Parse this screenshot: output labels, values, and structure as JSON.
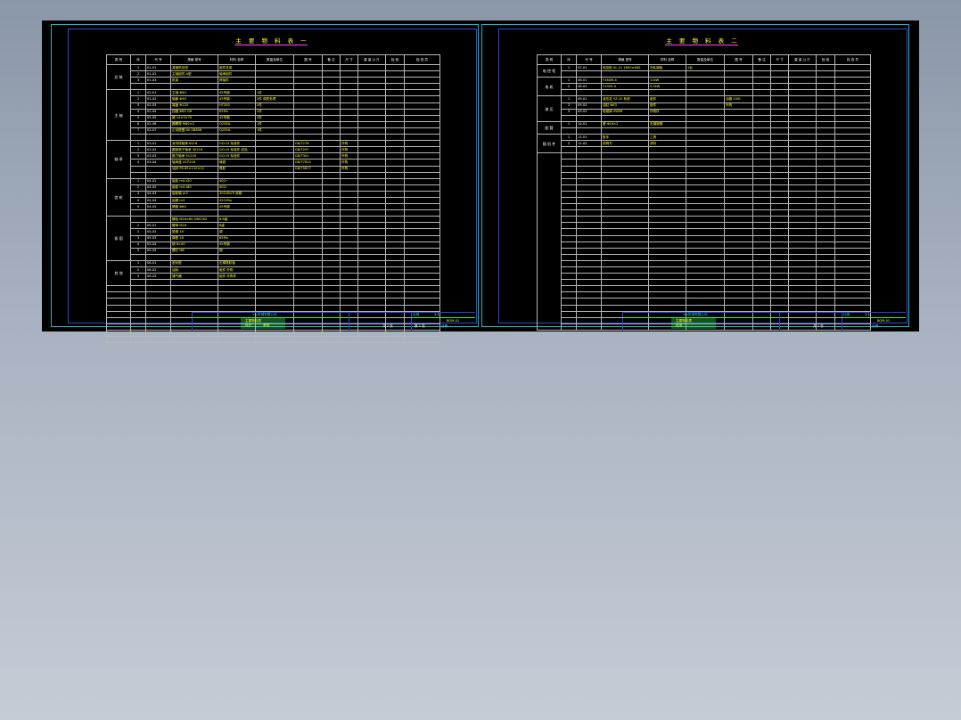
{
  "columns": [
    "类 别",
    "序",
    "代 号",
    "规格 型号",
    "材料 名称",
    "数量及单位",
    "图 号",
    "备 注",
    "尺 寸",
    "重 量 公 斤",
    "检 验",
    "检 查 员"
  ],
  "sheets": [
    {
      "title": "主 要 物 料 表 一",
      "groups": [
        {
          "category": "总 装",
          "rows": [
            {
              "idx": "1",
              "code": "01-01",
              "spec": "减速机总成",
              "name": "组件总成",
              "qty": "",
              "extra": ""
            },
            {
              "idx": "2",
              "code": "01-02",
              "spec": "主轴组件 A型",
              "name": "轴承组件",
              "qty": "",
              "extra": ""
            },
            {
              "idx": "3",
              "code": "01-03",
              "spec": "机架",
              "name": "焊接件",
              "qty": "",
              "extra": ""
            }
          ]
        },
        {
          "category": "主 轴",
          "rows": [
            {
              "idx": "1",
              "code": "02-01",
              "spec": "主轴 Φ80",
              "name": "45号钢",
              "qty": "1件",
              "extra": ""
            },
            {
              "idx": "2",
              "code": "02-02",
              "spec": "轴套 Φ90",
              "name": "45号钢",
              "qty": "2件 调质处理",
              "extra": ""
            },
            {
              "idx": "3",
              "code": "02-03",
              "spec": "端盖 Φ120",
              "name": "HT200",
              "qty": "2件",
              "extra": ""
            },
            {
              "idx": "4",
              "code": "02-04",
              "spec": "挡圈 Φ80 GB",
              "name": "65Mn",
              "qty": "2件",
              "extra": ""
            },
            {
              "idx": "5",
              "code": "02-05",
              "spec": "键 14×9×70",
              "name": "45号钢",
              "qty": "2件",
              "extra": ""
            },
            {
              "idx": "6",
              "code": "02-06",
              "spec": "圆螺母 M80×2",
              "name": "Q235A",
              "qty": "1件",
              "extra": ""
            },
            {
              "idx": "7",
              "code": "02-07",
              "spec": "止动垫圈 80 GB858",
              "name": "Q235A",
              "qty": "1件",
              "extra": ""
            }
          ]
        },
        {
          "category": "轴 承",
          "rows": [
            {
              "idx": "1",
              "code": "03-01",
              "spec": "深沟球轴承 6216",
              "name": "GCr15 标准件",
              "qty": "",
              "extra": "GB/T276",
              "extra2": "外购"
            },
            {
              "idx": "2",
              "code": "03-02",
              "spec": "圆锥滚子轴承 30216",
              "name": "GCr15 标准件 成品",
              "qty": "",
              "extra": "GB/T297",
              "extra2": "外购"
            },
            {
              "idx": "3",
              "code": "03-03",
              "spec": "推力轴承 51216",
              "name": "GCr15 标准件",
              "qty": "",
              "extra": "GB/T301",
              "extra2": "外购"
            },
            {
              "idx": "4",
              "code": "03-04",
              "spec": "轴承座 UCP216",
              "name": "铸铁",
              "qty": "",
              "extra": "GB/T7810",
              "extra2": "外购"
            },
            {
              "idx": "",
              "code": "",
              "spec": "油封 FB 85×110×12",
              "name": "橡胶",
              "qty": "",
              "extra": "GB/T9877",
              "extra2": "外购"
            }
          ]
        },
        {
          "category": "齿 轮",
          "rows": [
            {
              "idx": "1",
              "code": "04-01",
              "spec": "齿轮 m4 z20",
              "name": "40Cr",
              "qty": "",
              "extra": ""
            },
            {
              "idx": "2",
              "code": "04-02",
              "spec": "齿轮 m4 z80",
              "name": "40Cr",
              "qty": "",
              "extra": ""
            },
            {
              "idx": "3",
              "code": "04-03",
              "spec": "齿轮轴 m3",
              "name": "20CrMnTi 渗碳",
              "qty": "",
              "extra": ""
            },
            {
              "idx": "4",
              "code": "04-04",
              "spec": "齿圈 m3",
              "name": "42CrMo",
              "qty": "",
              "extra": ""
            },
            {
              "idx": "5",
              "code": "04-05",
              "spec": "隔套 Φ60",
              "name": "45号钢",
              "qty": "",
              "extra": ""
            }
          ]
        },
        {
          "category": "紧 固",
          "rows": [
            {
              "idx": "",
              "code": "",
              "spec": "螺栓 M16×60 GB5782",
              "name": "8.8级",
              "qty": "",
              "extra": ""
            },
            {
              "idx": "1",
              "code": "05-01",
              "spec": "螺母 M16",
              "name": "8级",
              "qty": "",
              "extra": ""
            },
            {
              "idx": "2",
              "code": "05-02",
              "spec": "垫圈 16",
              "name": "钢",
              "qty": "",
              "extra": ""
            },
            {
              "idx": "3",
              "code": "05-03",
              "spec": "弹垫 16",
              "name": "65Mn",
              "qty": "",
              "extra": ""
            },
            {
              "idx": "4",
              "code": "05-04",
              "spec": "销 8×40",
              "name": "45号钢",
              "qty": "",
              "extra": ""
            },
            {
              "idx": "5",
              "code": "05-05",
              "spec": "螺钉 M8",
              "name": "钢",
              "qty": "",
              "extra": ""
            }
          ]
        },
        {
          "category": "其 他",
          "rows": [
            {
              "idx": "1",
              "code": "06-01",
              "spec": "密封垫",
              "name": "石棉橡胶板",
              "qty": "",
              "extra": ""
            },
            {
              "idx": "2",
              "code": "06-02",
              "spec": "油标",
              "name": "组件 外购",
              "qty": "",
              "extra": ""
            },
            {
              "idx": "3",
              "code": "06-03",
              "spec": "通气器",
              "name": "组件 外购件",
              "qty": "",
              "extra": ""
            }
          ]
        }
      ]
    },
    {
      "title": "主 要 物 料 表 二",
      "groups": [
        {
          "category": "电 控 柜",
          "rows": [
            {
              "idx": "1",
              "code": "07-01",
              "spec": "电控柜 XL-21 1800×800",
              "name": "冷轧钢板",
              "qty": "1台",
              "extra": ""
            }
          ]
        },
        {
          "category": "电 机",
          "rows": [
            {
              "idx": "1",
              "code": "08-01",
              "spec": "Y160M-4",
              "name": "11kW",
              "qty": "",
              "extra": ""
            },
            {
              "idx": "2",
              "code": "08-02",
              "spec": "Y132S-4",
              "name": "5.5kW",
              "qty": "",
              "extra": ""
            }
          ]
        },
        {
          "category": "液 压",
          "rows": [
            {
              "idx": "1",
              "code": "09-01",
              "spec": "液压站 YZ-10 系统",
              "name": "组件",
              "qty": "",
              "extra": "油箱 100L",
              "extra2": ""
            },
            {
              "idx": "2",
              "code": "09-02",
              "spec": "油缸 Φ63",
              "name": "组件",
              "qty": "",
              "extra": "外购",
              "extra2": ""
            },
            {
              "idx": "3",
              "code": "09-03",
              "spec": "电磁阀 4WE6",
              "name": "外购件",
              "qty": "",
              "extra": ""
            }
          ]
        },
        {
          "category": "配 管",
          "rows": [
            {
              "idx": "1",
              "code": "10-01",
              "spec": "管 Φ16×2",
              "name": "无缝钢管",
              "qty": "",
              "extra": ""
            }
          ]
        },
        {
          "category": "随 机 件",
          "rows": [
            {
              "idx": "1",
              "code": "11-01",
              "spec": "扳手",
              "name": "工具",
              "qty": "",
              "extra": ""
            },
            {
              "idx": "2",
              "code": "11-02",
              "spec": "说明书",
              "name": "资料",
              "qty": "",
              "extra": ""
            }
          ]
        }
      ]
    }
  ],
  "title_block": {
    "company": "××机械有限公司",
    "drawing_name": "主要物料表",
    "drawing_no": "BOM-01",
    "scale_label": "比例",
    "scale": "1:1",
    "sheet_label": "共 2 张",
    "sheet_no": "第 1 张",
    "design": "设计",
    "check": "审核",
    "approve": "批准",
    "date": "日期"
  }
}
